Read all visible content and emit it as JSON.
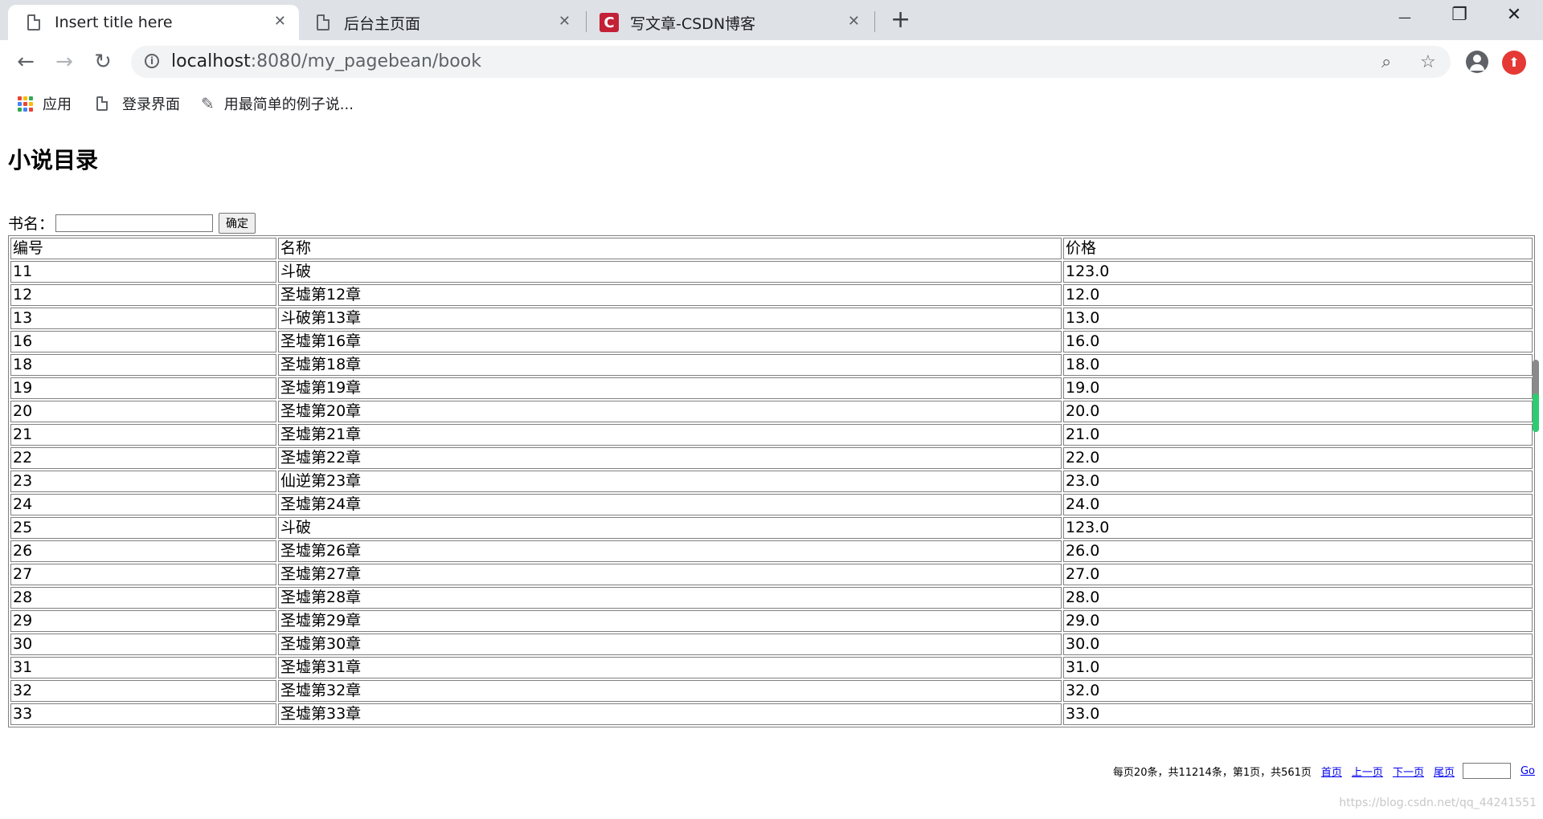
{
  "browser": {
    "tabs": [
      {
        "title": "Insert title here",
        "active": true
      },
      {
        "title": "后台主页面",
        "active": false
      },
      {
        "title": "写文章-CSDN博客",
        "active": false,
        "icon": "csdn-icon"
      }
    ],
    "new_tab_icon": "+",
    "window_controls": {
      "minimize": "—",
      "restore": "❐",
      "close": "✕"
    },
    "tab_close_glyph": "✕"
  },
  "toolbar": {
    "back_icon": "←",
    "forward_icon": "→",
    "reload_icon": "↻",
    "url_host": "localhost",
    "url_path": ":8080/my_pagebean/book",
    "zoom_icon": "⌕",
    "star_icon": "☆",
    "extension_icon": "⬆"
  },
  "bookmarks": [
    {
      "label": "应用",
      "icon": "apps-icon"
    },
    {
      "label": "登录界面",
      "icon": "doc-icon"
    },
    {
      "label": "用最简单的例子说...",
      "icon": "bookmark-icon"
    }
  ],
  "page": {
    "heading": "小说目录",
    "search_label": "书名：",
    "search_value": "",
    "search_button": "确定",
    "table": {
      "headers": [
        "编号",
        "名称",
        "价格"
      ],
      "rows": [
        [
          "11",
          "斗破",
          "123.0"
        ],
        [
          "12",
          "圣墟第12章",
          "12.0"
        ],
        [
          "13",
          "斗破第13章",
          "13.0"
        ],
        [
          "16",
          "圣墟第16章",
          "16.0"
        ],
        [
          "18",
          "圣墟第18章",
          "18.0"
        ],
        [
          "19",
          "圣墟第19章",
          "19.0"
        ],
        [
          "20",
          "圣墟第20章",
          "20.0"
        ],
        [
          "21",
          "圣墟第21章",
          "21.0"
        ],
        [
          "22",
          "圣墟第22章",
          "22.0"
        ],
        [
          "23",
          "仙逆第23章",
          "23.0"
        ],
        [
          "24",
          "圣墟第24章",
          "24.0"
        ],
        [
          "25",
          "斗破",
          "123.0"
        ],
        [
          "26",
          "圣墟第26章",
          "26.0"
        ],
        [
          "27",
          "圣墟第27章",
          "27.0"
        ],
        [
          "28",
          "圣墟第28章",
          "28.0"
        ],
        [
          "29",
          "圣墟第29章",
          "29.0"
        ],
        [
          "30",
          "圣墟第30章",
          "30.0"
        ],
        [
          "31",
          "圣墟第31章",
          "31.0"
        ],
        [
          "32",
          "圣墟第32章",
          "32.0"
        ],
        [
          "33",
          "圣墟第33章",
          "33.0"
        ]
      ]
    },
    "pager": {
      "summary": "每页20条，共11214条，第1页，共561页",
      "first": "首页",
      "prev": "上一页",
      "next": "下一页",
      "last": "尾页",
      "go": "Go"
    },
    "watermark": "https://blog.csdn.net/qq_44241551"
  }
}
